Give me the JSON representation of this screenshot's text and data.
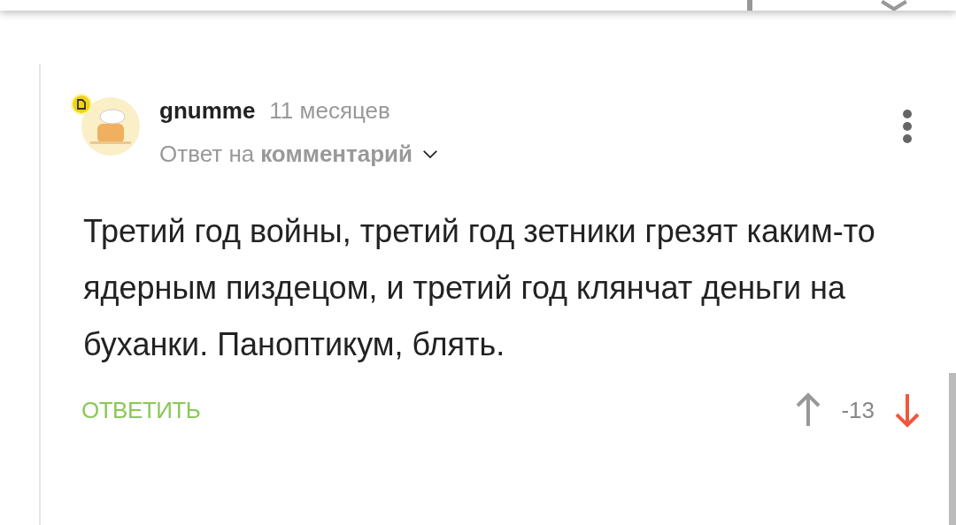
{
  "comment": {
    "author": "gnumme",
    "time": "11 месяцев",
    "reply_prefix": "Ответ на",
    "reply_target": "комментарий",
    "reply_expanded": false,
    "text": "Третий год войны, третий год зетники грезят каким-то ядерным пиздецом, и третий год клянчат деньги на буханки. Паноптикум, блять.",
    "reply_button": "ОТВЕТИТЬ",
    "rating": "-13",
    "upvoted": false,
    "downvoted": true
  }
}
